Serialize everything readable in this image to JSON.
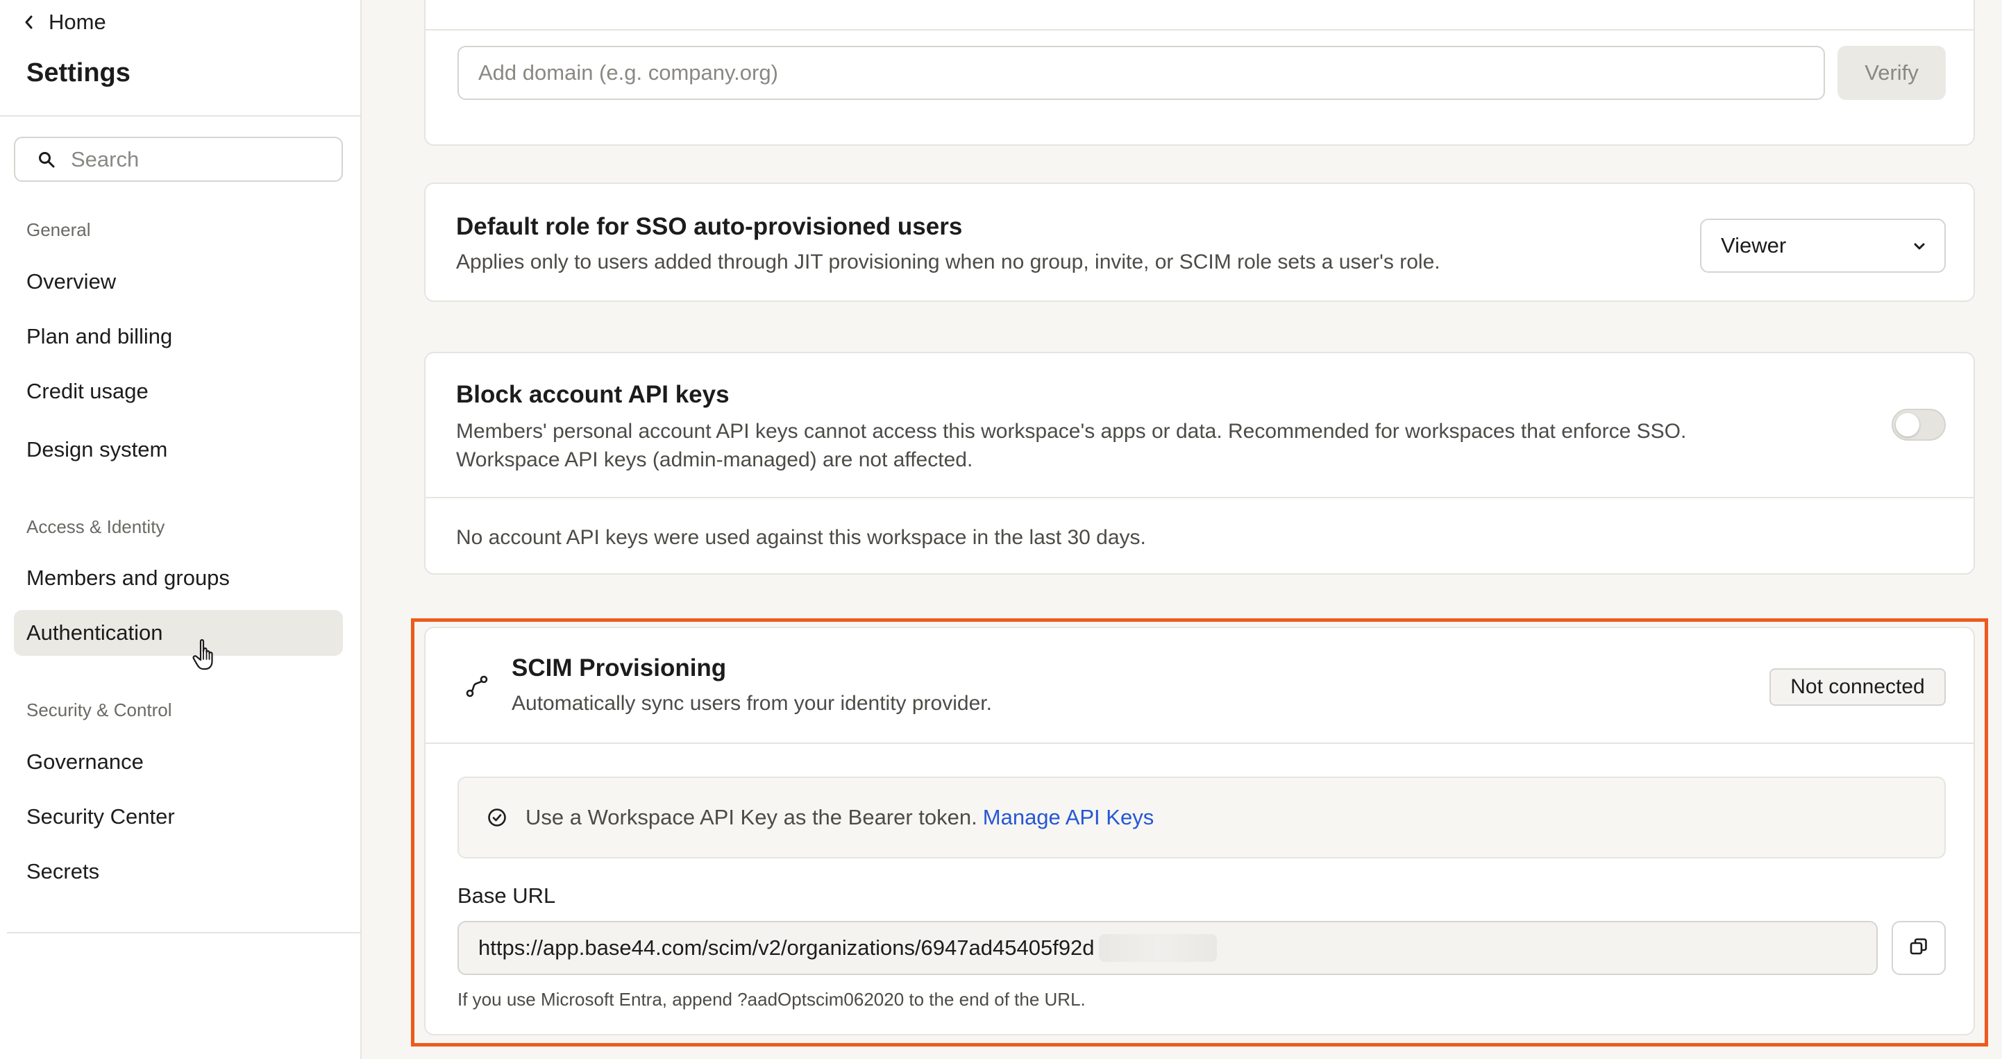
{
  "sidebar": {
    "home_label": "Home",
    "title": "Settings",
    "search_placeholder": "Search",
    "sections": {
      "general": "General",
      "access": "Access & Identity",
      "security": "Security & Control"
    },
    "items": {
      "overview": "Overview",
      "plan_billing": "Plan and billing",
      "credit_usage": "Credit usage",
      "design_system": "Design system",
      "members_groups": "Members and groups",
      "authentication": "Authentication",
      "governance": "Governance",
      "security_center": "Security Center",
      "secrets": "Secrets"
    },
    "active_item": "Authentication"
  },
  "domain_card": {
    "input_placeholder": "Add domain (e.g. company.org)",
    "verify_label": "Verify"
  },
  "default_role_card": {
    "title": "Default role for SSO auto-provisioned users",
    "description": "Applies only to users added through JIT provisioning when no group, invite, or SCIM role sets a user's role.",
    "selected_role": "Viewer"
  },
  "api_keys_card": {
    "title": "Block account API keys",
    "description_line1": "Members' personal account API keys cannot access this workspace's apps or data. Recommended for workspaces that enforce SSO.",
    "description_line2": "Workspace API keys (admin-managed) are not affected.",
    "toggle_on": false,
    "usage_note": "No account API keys were used against this workspace in the last 30 days."
  },
  "scim_card": {
    "title": "SCIM Provisioning",
    "description": "Automatically sync users from your identity provider.",
    "status": "Not connected",
    "info_text": "Use a Workspace API Key as the Bearer token.",
    "info_link": "Manage API Keys",
    "base_url_label": "Base URL",
    "base_url_value": "https://app.base44.com/scim/v2/organizations/6947ad45405f92d",
    "hint": "If you use Microsoft Entra, append ?aadOptscim062020 to the end of the URL."
  },
  "colors": {
    "highlight": "#ee5a1d",
    "link": "#2556d6",
    "active_item_bg": "#ebe9e4",
    "page_bg": "#f7f6f3"
  }
}
